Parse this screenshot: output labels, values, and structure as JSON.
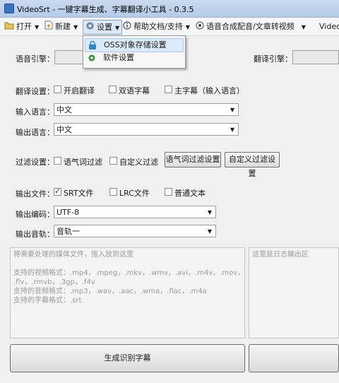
{
  "window": {
    "title": "VideoSrt - 一键字幕生成、字幕翻译小工具 - 0.3.5"
  },
  "menu": {
    "open": "打开",
    "new": "新建",
    "settings": "设置",
    "help": "帮助文档/支持",
    "tts": "语音合成配音/文章转视频",
    "video": "Video"
  },
  "settings_menu": {
    "oss": "OSS对象存储设置",
    "software": "软件设置"
  },
  "form": {
    "voice_engine_label": "语音引擎：",
    "translate_engine_label": "翻译引擎：",
    "translate_settings_label": "翻译设置：",
    "enable_translate": "开启翻译",
    "bilingual": "双语字幕",
    "main_subtitle": "主字幕（输入语言）",
    "input_lang_label": "输入语言：",
    "input_lang_value": "中文",
    "output_lang_label": "输出语言：",
    "output_lang_value": "中文",
    "filter_label": "过滤设置：",
    "filler_filter": "语气词过滤",
    "custom_filter": "自定义过滤",
    "filler_filter_btn": "语气词过滤设置",
    "custom_filter_btn": "自定义过滤设置",
    "output_file_label": "输出文件：",
    "srt": "SRT文件",
    "lrc": "LRC文件",
    "txt": "普通文本",
    "encoding_label": "输出编码：",
    "encoding_value": "UTF-8",
    "track_label": "输出音轨：",
    "track_value": "音轨一"
  },
  "drop_area": {
    "lines": [
      "将需要处理的媒体文件，拖入放到这里",
      "",
      "支持的视频格式：.mp4，.mpeg，.mkv，.wmv，.avi，.m4v，.mov，",
      ".flv，.rmvb，.3gp，.f4v",
      "支持的音频格式：.mp3，.wav，.aac，.wma，.flac，.m4a",
      "支持的字幕格式：.srt"
    ]
  },
  "log_area": {
    "placeholder": "这里是日志输出区"
  },
  "actions": {
    "generate": "生成识别字幕"
  }
}
